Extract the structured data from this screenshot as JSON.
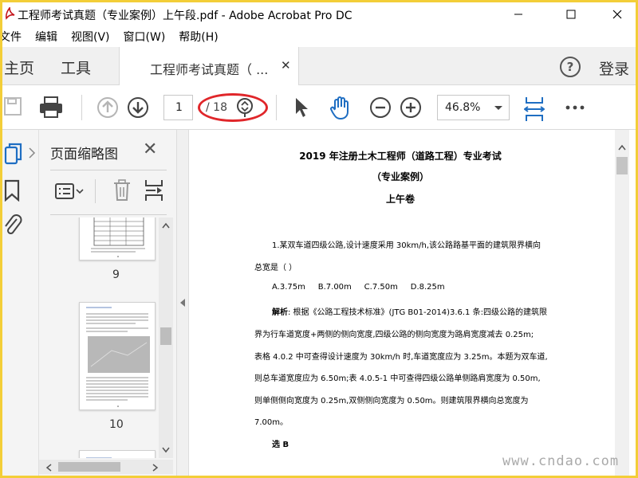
{
  "window": {
    "title": "工程师考试真题（专业案例）上午段.pdf - Adobe Acrobat Pro DC",
    "min_glyph": "─",
    "max_glyph": "☐",
    "close_glyph": "✕"
  },
  "menu": [
    "文件",
    "编辑",
    "视图(V)",
    "窗口(W)",
    "帮助(H)"
  ],
  "tabs": {
    "home": "主页",
    "tools": "工具",
    "doc_label": "工程师考试真题（ ...",
    "doc_close": "✕",
    "help": "?",
    "login": "登录"
  },
  "toolbar": {
    "current_page": "1",
    "total_pages": "18",
    "zoom": "46.8%"
  },
  "thumbnails": {
    "title": "页面缩略图",
    "close": "✕",
    "pages": [
      "9",
      "10"
    ]
  },
  "document": {
    "title1": "2019 年注册土木工程师（道路工程）专业考试",
    "title2": "（专业案例）",
    "title3": "上午卷",
    "q1_line1": "1.某双车道四级公路,设计速度采用 30km/h,该公路路基平面的建筑限界横向",
    "q1_line2": "总宽是（ ）",
    "options": "A.3.75m     B.7.00m     C.7.50m     D.8.25m",
    "analysis_label": "解析",
    "analysis_line1": ": 根据《公路工程技术标准》(JTG B01-2014)3.6.1 条:四级公路的建筑限",
    "analysis_line2": "界为行车道宽度+两侧的侧向宽度,四级公路的侧向宽度为路肩宽度减去  0.25m;",
    "analysis_line3": "表格 4.0.2 中可查得设计速度为 30km/h 时,车道宽度应为 3.25m。本题为双车道,",
    "analysis_line4": "则总车道宽度应为 6.50m;表 4.0.5-1 中可查得四级公路单侧路肩宽度为 0.50m,",
    "analysis_line5": "则单侧侧向宽度为  0.25m,双侧侧向宽度为  0.50m。则建筑限界横向总宽度为",
    "analysis_line6": "7.00m。",
    "answer": "选 B"
  },
  "watermark": "www.cndao.com",
  "colors": {
    "frame": "#f3ce38",
    "highlight_ellipse": "#e0262a",
    "accent_blue": "#1f6ec2"
  }
}
